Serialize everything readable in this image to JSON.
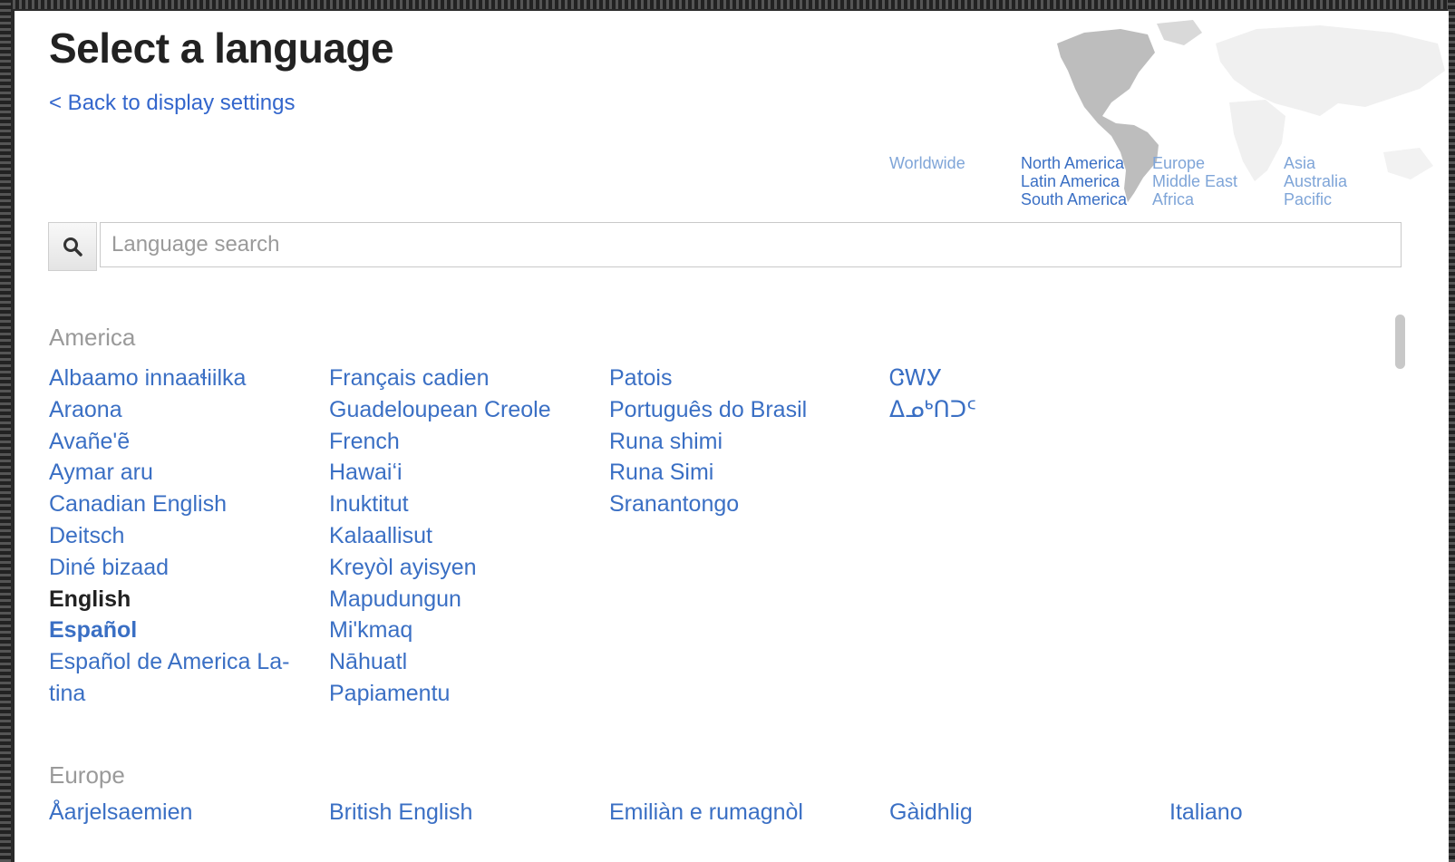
{
  "page": {
    "title": "Select a language",
    "back_link": "< Back to display settings"
  },
  "regions": [
    {
      "lines": [
        "Worldwide"
      ]
    },
    {
      "lines": [
        "North America",
        "Latin America",
        "South America"
      ]
    },
    {
      "lines": [
        "Europe",
        "Middle East",
        "Africa"
      ]
    },
    {
      "lines": [
        "Asia",
        "Australia",
        "Pacific"
      ]
    }
  ],
  "search": {
    "icon": "search-icon",
    "placeholder": "Language search",
    "value": ""
  },
  "sections": {
    "america": {
      "heading": "America",
      "columns": [
        [
          "Albaamo innaaɬiilka",
          "Araona",
          "Avañe'ẽ",
          "Aymar aru",
          "Canadian English",
          "Deitsch",
          "Diné bizaad",
          "English",
          "Español",
          "Español de America La-tina"
        ],
        [
          "Français cadien",
          "Guadeloupean Creole",
          "French",
          "Hawaiʻi",
          "Inuktitut",
          "Kalaallisut",
          "Kreyòl ayisyen",
          "Mapudungun",
          "Mi'kmaq",
          "Nāhuatl",
          "Papiamentu"
        ],
        [
          "Patois",
          "Português do Brasil",
          "Runa shimi",
          "Runa Simi",
          "Sranantongo"
        ],
        [
          "ᏣᎳᎩ",
          "ᐃᓄᒃᑎᑐᑦ"
        ]
      ],
      "current": "English",
      "bold_link": "Español"
    },
    "europe": {
      "heading": "Europe",
      "items": [
        "Åarjelsaemien",
        "British English",
        "Emiliàn e rumagnòl",
        "Gàidhlig",
        "Italiano"
      ]
    }
  },
  "colors": {
    "link": "#3a6fc4",
    "heading": "#222222",
    "section_heading": "#9a9a9a",
    "map": "#bdbdbd"
  }
}
